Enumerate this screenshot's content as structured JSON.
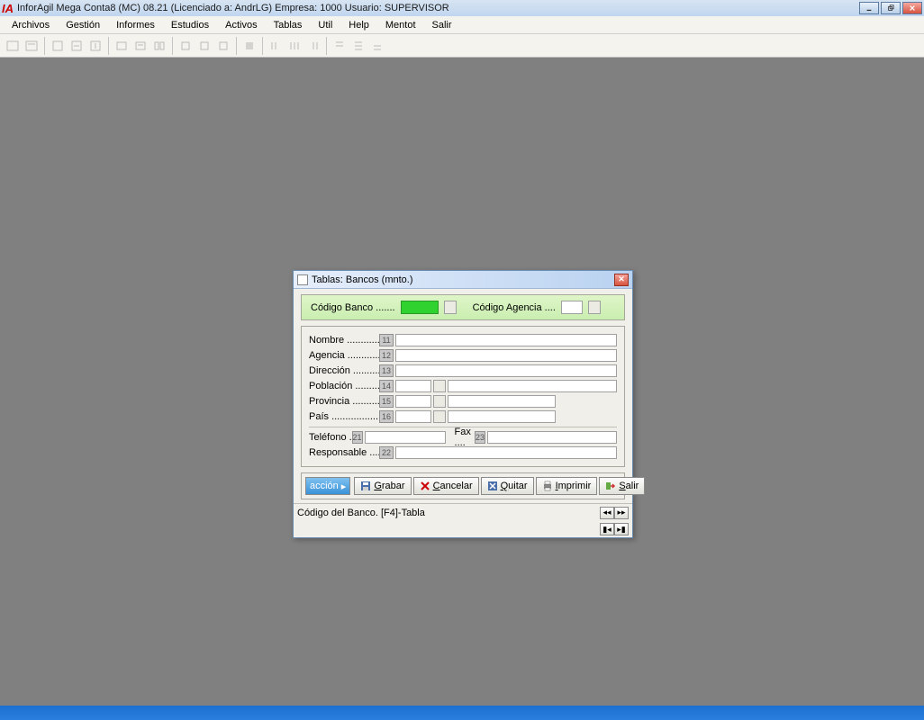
{
  "app_title": "InforAgil Mega Conta8 (MC) 08.21  (Licenciado a: AndrLG)  Empresa: 1000  Usuario: SUPERVISOR",
  "menu": [
    "Archivos",
    "Gestión",
    "Informes",
    "Estudios",
    "Activos",
    "Tablas",
    "Util",
    "Help",
    "Mentot",
    "Salir"
  ],
  "dialog": {
    "title": "Tablas: Bancos (mnto.)",
    "codigo_banco_label": "Código Banco .......",
    "codigo_agencia_label": "Código Agencia ....",
    "fields": {
      "nombre": {
        "label": "Nombre ..................",
        "num": "11"
      },
      "agencia": {
        "label": "Agencia .................",
        "num": "12"
      },
      "direccion": {
        "label": "Dirección ...............",
        "num": "13"
      },
      "poblacion": {
        "label": "Población ..............",
        "num": "14"
      },
      "provincia": {
        "label": "Provincia ...............",
        "num": "15"
      },
      "pais": {
        "label": "País ......................",
        "num": "16"
      },
      "telefono": {
        "label": "Teléfono ................",
        "num": "21"
      },
      "fax": {
        "label": "Fax ....",
        "num": "23"
      },
      "responsable": {
        "label": "Responsable .........",
        "num": "22"
      }
    },
    "buttons": {
      "accion": "acción",
      "grabar": "Grabar",
      "cancelar": "Cancelar",
      "quitar": "Quitar",
      "imprimir": "Imprimir",
      "salir": "Salir"
    },
    "status": "Código del Banco. [F4]-Tabla"
  }
}
